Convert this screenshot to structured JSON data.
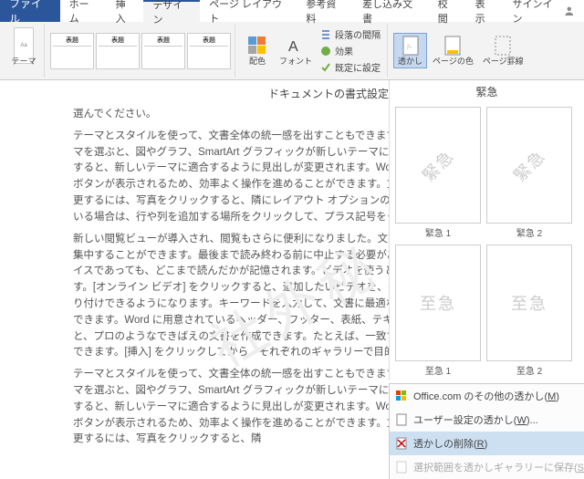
{
  "tabs": {
    "file": "ファイル",
    "home": "ホーム",
    "insert": "挿入",
    "design": "デザイン",
    "layout": "ページ レイアウト",
    "references": "参考資料",
    "mailings": "差し込み文書",
    "review": "校閲",
    "view": "表示"
  },
  "signin": "サインイン",
  "ribbon": {
    "themes": "テーマ",
    "gallery_item": "表題",
    "formatting": {
      "paragraph_spacing": "段落の間隔",
      "effects": "効果",
      "set_default": "既定に設定",
      "colors": "配色",
      "fonts": "フォント"
    },
    "page_bg": {
      "watermark": "透かし",
      "page_color": "ページの色",
      "page_borders": "ページ罫線"
    }
  },
  "doc": {
    "title": "ドキュメントの書式設定",
    "p1": "選んでください。",
    "p2": "テーマとスタイルを使って、文書全体の統一感を出すこともできます。[デザイン] をクリックし新しいテーマを選ぶと、図やグラフ、SmartArt グラフィックが新しいテーマに合わせて変わります。スタイルを適用すると、新しいテーマに適合するように見出しが変更されます。Word では、必要に応じてその場に新しいボタンが表示されるため、効率よく操作を進めることができます。文書内に写真をレイアウトする方法を変更するには、写真をクリックすると、隣にレイアウト オプションのボタンが表示されます。表で作業している場合は、行や列を追加する場所をクリックして、プラス記号をクリックします。",
    "p3": "新しい閲覧ビューが導入され、閲覧もさらに便利になりました。文書の一部を折りたたんで、必要な箇所に集中することができます。最後まで読み終わる前に中止する必要がある場合、Word では、たとえ別のデバイスであっても、どこまで読んだかが記憶されます。ビデオを使うと、伝えたい内容を明確に表現できます。[オンライン ビデオ] をクリックすると、追加したいビデオを、それに応じた埋め込みコードの形式で貼り付けできるようになります。キーワードを入力して、文書に最適なビデオをオンラインで検索することもできます。Word に用意されているヘッダー、フッター、表紙、テキスト ボックス デザインを組み合わせると、プロのようなできばえの文書を作成できます。たとえば、一致する表紙、ヘッダー、サイドバーを追加できます。[挿入] をクリックしてから、それぞれのギャラリーで目的の要素を選んでください。",
    "p4": "テーマとスタイルを使って、文書全体の統一感を出すこともできます。[デザイン] をクリックし新しいテーマを選ぶと、図やグラフ、SmartArt グラフィックが新しいテーマに合わせて変わります。スタイルを適用すると、新しいテーマに適合するように見出しが変更されます。Word では、必要に応じてその場に新しいボタンが表示されるため、効率よく操作を進めることができます。文書内に写真をレイアウトする方法を変更するには、写真をクリックすると、隣",
    "watermark_text": "社外秘"
  },
  "panel": {
    "title": "緊急",
    "items": [
      {
        "text": "緊急",
        "label": "緊急 1",
        "rot": true
      },
      {
        "text": "緊急",
        "label": "緊急 2",
        "rot": true
      },
      {
        "text": "至急",
        "label": "至急 1",
        "rot": false
      },
      {
        "text": "至急",
        "label": "至急 2",
        "rot": false
      }
    ]
  },
  "menu": {
    "office": "Office.com のその他の透かし",
    "office_key": "M",
    "custom": "ユーザー設定の透かし",
    "custom_key": "W",
    "remove": "透かしの削除",
    "remove_key": "R",
    "save": "選択範囲を透かしギャラリーに保存",
    "save_key": "S"
  }
}
